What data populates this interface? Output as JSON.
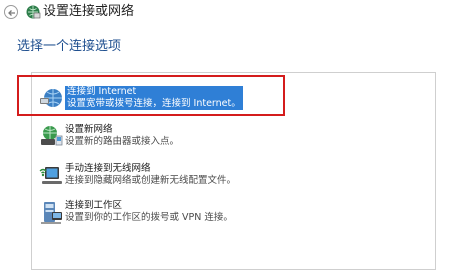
{
  "window": {
    "title": "设置连接或网络"
  },
  "instruction": "选择一个连接选项",
  "options": [
    {
      "title": "连接到 Internet",
      "description": "设置宽带或拨号连接，连接到 Internet。",
      "icon": "globe-network-icon",
      "selected": true
    },
    {
      "title": "设置新网络",
      "description": "设置新的路由器或接入点。",
      "icon": "router-network-icon",
      "selected": false
    },
    {
      "title": "手动连接到无线网络",
      "description": "连接到隐藏网络或创建新无线配置文件。",
      "icon": "wireless-computer-icon",
      "selected": false
    },
    {
      "title": "连接到工作区",
      "description": "设置到你的工作区的拨号或 VPN 连接。",
      "icon": "workplace-computer-icon",
      "selected": false
    }
  ],
  "colors": {
    "selection": "#2f7fd6",
    "highlight_frame": "#d41c1c",
    "instruction_text": "#1f4f8f"
  }
}
